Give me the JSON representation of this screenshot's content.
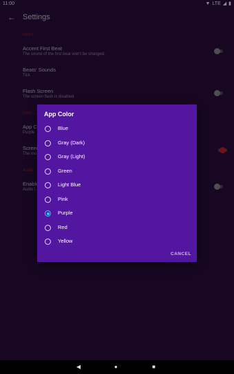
{
  "status": {
    "time": "11:00",
    "network": "LTE"
  },
  "app": {
    "title": "Settings"
  },
  "sections": [
    {
      "header": "Metro",
      "items": [
        {
          "title": "Accent First Beat",
          "subtitle": "The sound of the first beat won't be changed."
        },
        {
          "title": "Beats' Sounds",
          "subtitle": "Tick"
        },
        {
          "title": "Flash Screen",
          "subtitle": "The screen flash is disabled"
        }
      ]
    },
    {
      "header": "User i...",
      "items": [
        {
          "title": "App Co...",
          "subtitle": "Purple"
        },
        {
          "title": "Screen...",
          "subtitle": "The mo..."
        }
      ]
    },
    {
      "header": "Audio",
      "items": [
        {
          "title": "Enable ...",
          "subtitle": "Audio l..."
        }
      ]
    }
  ],
  "dialog": {
    "title": "App Color",
    "options": [
      "Blue",
      "Gray (Dark)",
      "Gray (Light)",
      "Green",
      "Light Blue",
      "Pink",
      "Purple",
      "Red",
      "Yellow"
    ],
    "selected": "Purple",
    "cancel_label": "CANCEL"
  },
  "colors": {
    "background": "#2a0d3f",
    "dialog": "#5316a0",
    "accent": "#2bd0f0",
    "section_header": "#b31b1b"
  }
}
